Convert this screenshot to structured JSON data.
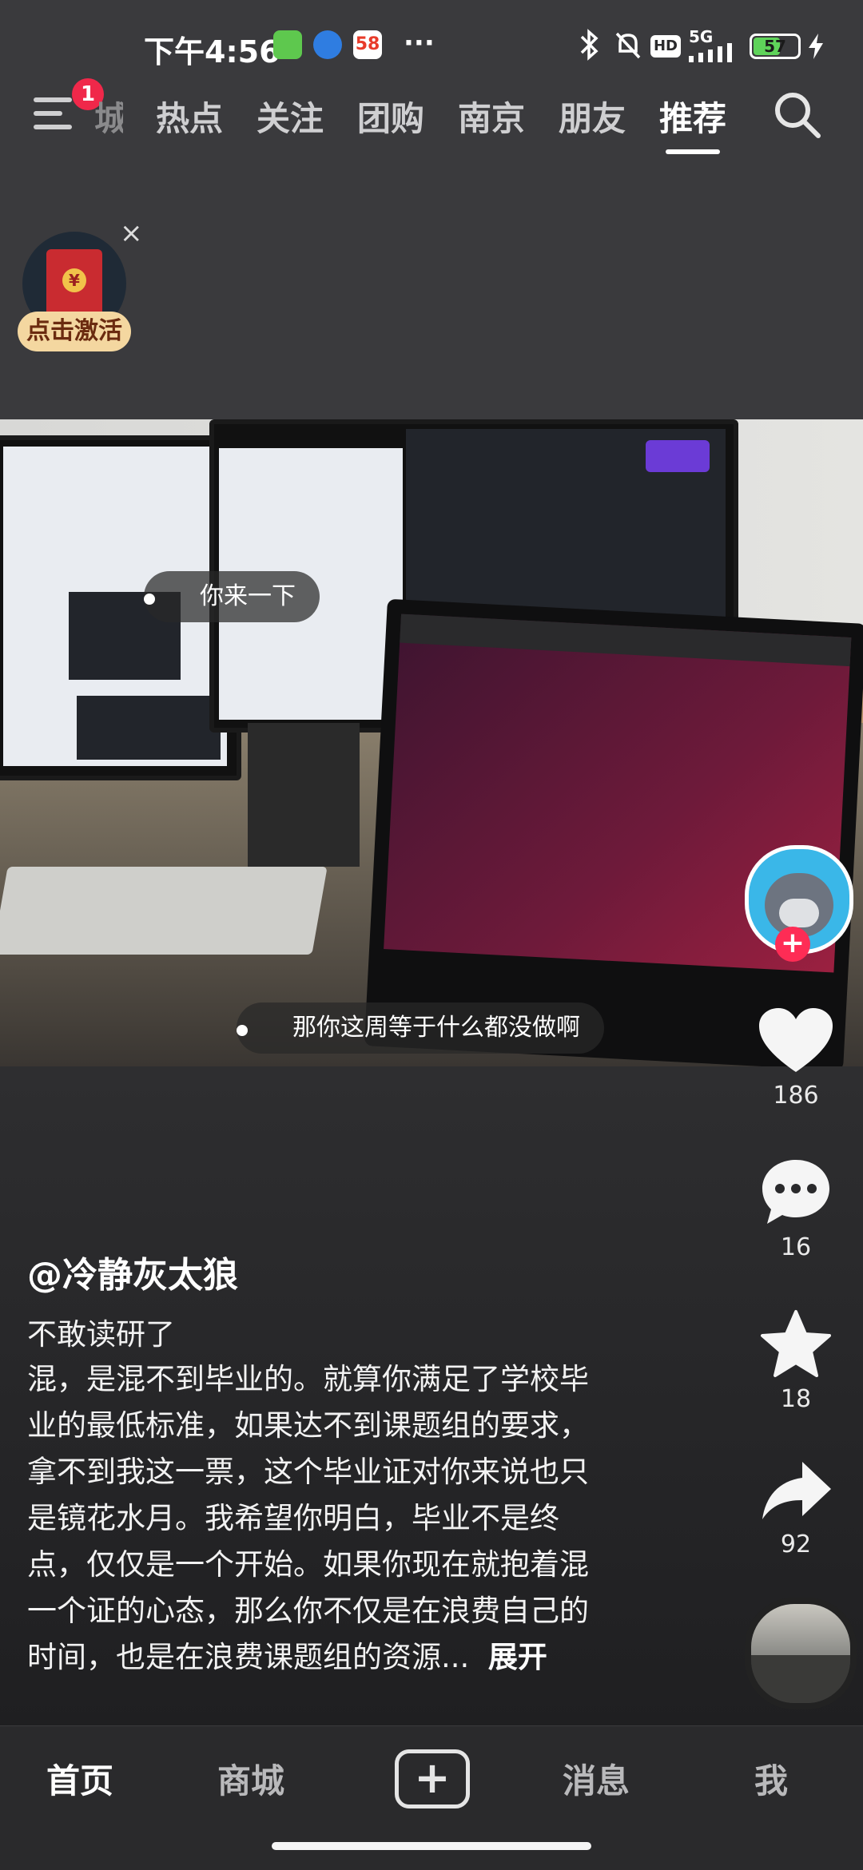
{
  "status_bar": {
    "time": "下午4:56",
    "icon_58": "58",
    "more": "···",
    "hd": "HD",
    "network": "5G",
    "battery": "57"
  },
  "header": {
    "notification_count": "1",
    "tabs": [
      {
        "label": "热点"
      },
      {
        "label": "关注"
      },
      {
        "label": "团购"
      },
      {
        "label": "南京"
      },
      {
        "label": "朋友"
      },
      {
        "label": "推荐"
      }
    ],
    "partial_tab": "城"
  },
  "promo": {
    "label": "点击激活",
    "close": "×",
    "coin": "¥"
  },
  "video": {
    "comments": [
      {
        "text": "你来一下"
      },
      {
        "text": "那你这周等于什么都没做啊"
      }
    ]
  },
  "actions": {
    "likes": "186",
    "comments": "16",
    "favorites": "18",
    "shares": "92",
    "follow": "+"
  },
  "post": {
    "username": "@冷静灰太狼",
    "title": "不敢读研了",
    "body_lines": [
      "混，是混不到毕业的。就算你满足了学校毕",
      "业的最低标准，如果达不到课题组的要求，",
      "拿不到我这一票，这个毕业证对你来说也只",
      "是镜花水月。我希望你明白，毕业不是终",
      "点，仅仅是一个开始。如果你现在就抱着混",
      "一个证的心态，那么你不仅是在浪费自己的",
      "时间，也是在浪费课题组的资源..."
    ],
    "expand": "展开"
  },
  "nav": {
    "home": "首页",
    "mall": "商城",
    "create": "+",
    "messages": "消息",
    "me": "我"
  },
  "colors": {
    "accent": "#fe2c55",
    "background": "#2a2a2c"
  }
}
